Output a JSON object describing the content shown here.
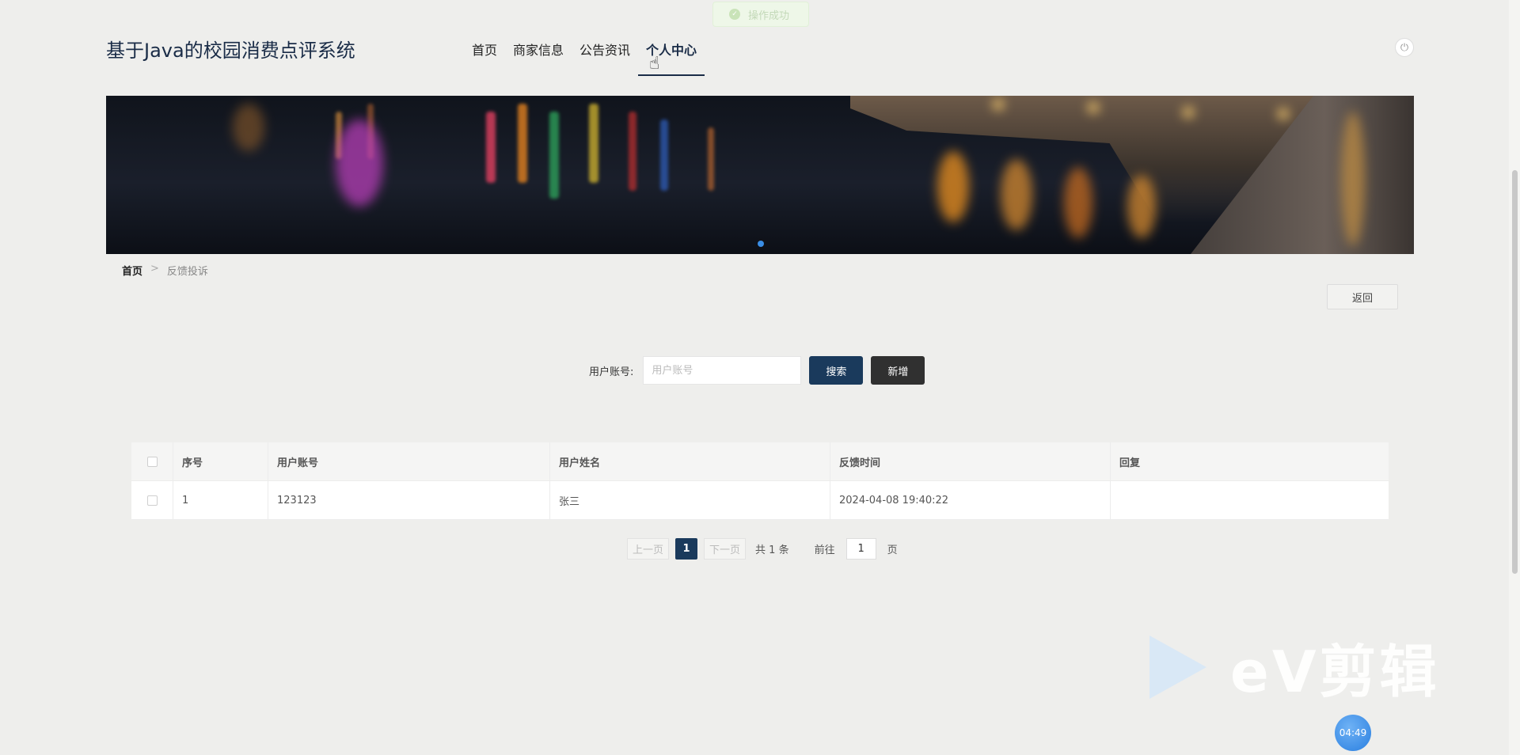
{
  "toast": {
    "text": "操作成功"
  },
  "header": {
    "site_title": "基于Java的校园消费点评系统",
    "nav": [
      {
        "label": "首页"
      },
      {
        "label": "商家信息"
      },
      {
        "label": "公告资讯"
      },
      {
        "label": "个人中心",
        "active": true
      }
    ],
    "power_icon": "power-icon"
  },
  "breadcrumb": {
    "home": "首页",
    "separator": ">",
    "current": "反馈投诉"
  },
  "actions": {
    "back_label": "返回"
  },
  "search": {
    "label": "用户账号:",
    "placeholder": "用户账号",
    "value": "",
    "search_label": "搜索",
    "add_label": "新增"
  },
  "table": {
    "columns": [
      "序号",
      "用户账号",
      "用户姓名",
      "反馈时间",
      "回复"
    ],
    "rows": [
      {
        "index": "1",
        "account": "123123",
        "name": "张三",
        "time": "2024-04-08 19:40:22",
        "reply": ""
      }
    ]
  },
  "pagination": {
    "prev_label": "上一页",
    "next_label": "下一页",
    "current_page": "1",
    "total_text": "共 1 条",
    "goto_label": "前往",
    "goto_value": "1",
    "page_suffix": "页"
  },
  "watermark": {
    "text": "eV剪辑"
  },
  "recording_timer": "04:49",
  "colors": {
    "primary": "#1a3a5c",
    "dark_button": "#303030",
    "background": "#eeeeec"
  }
}
